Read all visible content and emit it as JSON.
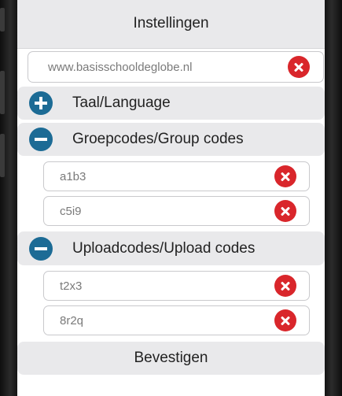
{
  "header": {
    "title": "Instellingen"
  },
  "server": {
    "url": "www.basisschooldeglobe.nl"
  },
  "sections": {
    "language": {
      "label": "Taal/Language",
      "state": "collapsed"
    },
    "group_codes": {
      "label": "Groepcodes/Group codes",
      "state": "expanded",
      "codes": [
        "a1b3",
        "c5i9"
      ]
    },
    "upload_codes": {
      "label": "Uploadcodes/Upload codes",
      "state": "expanded",
      "codes": [
        "t2x3",
        "8r2q"
      ]
    }
  },
  "confirm": {
    "label": "Bevestigen"
  },
  "colors": {
    "accent": "#1c6b95",
    "clear": "#d9262b",
    "section_bg": "#e9e9eb"
  },
  "icons": {
    "expand": "plus-circle-icon",
    "collapse": "minus-circle-icon",
    "clear": "clear-circle-icon"
  }
}
